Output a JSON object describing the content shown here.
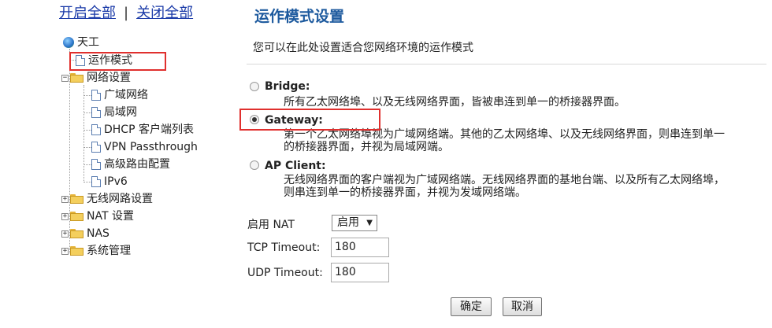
{
  "toplinks": {
    "expand_all": "开启全部",
    "separator": "|",
    "collapse_all": "关闭全部"
  },
  "tree": {
    "root": "天工",
    "operation_mode": "运作模式",
    "network_settings": "网络设置",
    "wan": "广域网络",
    "lan": "局域网",
    "dhcp": "DHCP 客户端列表",
    "vpn": "VPN Passthrough",
    "routing": "高级路由配置",
    "ipv6": "IPv6",
    "wireless": "无线网路设置",
    "nat": "NAT 设置",
    "nas": "NAS",
    "sysadmin": "系统管理"
  },
  "content": {
    "title": "运作模式设置",
    "description": "您可以在此处设置适合您网络环境的运作模式",
    "modes": [
      {
        "label": "Bridge:",
        "checked": false,
        "desc": [
          "所有乙太网络埠、以及无线网络界面，皆被串连到单一的桥接器界面。"
        ]
      },
      {
        "label": "Gateway:",
        "checked": true,
        "desc": [
          "第一个乙太网络埠视为广域网络端。其他的乙太网络埠、以及无线网络界面，则串连到单一",
          "的桥接器界面，并视为局域网端。"
        ]
      },
      {
        "label": "AP Client:",
        "checked": false,
        "desc": [
          "无线网络界面的客户端视为广域网络端。无线网络界面的基地台端、以及所有乙太网络埠，",
          "则串连到单一的桥接器界面，并视为发域网络端。"
        ]
      }
    ],
    "nat_label": "启用 NAT",
    "nat_value": "启用",
    "tcp_label": "TCP Timeout:",
    "tcp_value": "180",
    "udp_label": "UDP Timeout:",
    "udp_value": "180",
    "ok_label": "确定",
    "cancel_label": "取消"
  },
  "colors": {
    "title": "#1d5a9e",
    "link": "#1a3aa8",
    "highlight": "#e0302e"
  }
}
